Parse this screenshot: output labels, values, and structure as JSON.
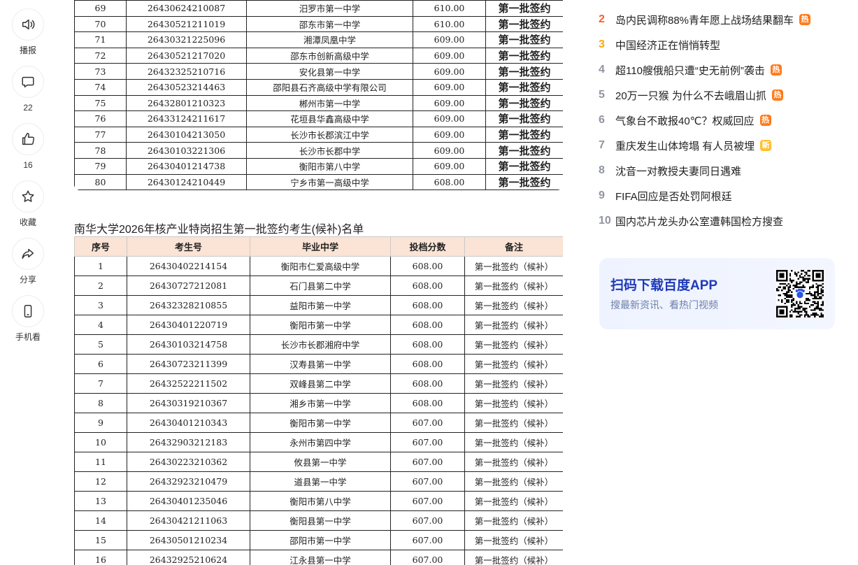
{
  "actions": [
    {
      "name": "broadcast-button",
      "icon": "speaker-icon",
      "label": "播报"
    },
    {
      "name": "comment-button",
      "icon": "comment-icon",
      "label": "22"
    },
    {
      "name": "like-button",
      "icon": "thumbs-up-icon",
      "label": "16"
    },
    {
      "name": "favorite-button",
      "icon": "star-icon",
      "label": "收藏"
    },
    {
      "name": "share-button",
      "icon": "share-icon",
      "label": "分享"
    },
    {
      "name": "mobile-view-button",
      "icon": "phone-icon",
      "label": "手机看"
    }
  ],
  "table1": {
    "status_label": "第一批签约",
    "rows": [
      [
        "69",
        "26430624210087",
        "汨罗市第一中学",
        "610.00"
      ],
      [
        "70",
        "26430521211019",
        "邵东市第一中学",
        "610.00"
      ],
      [
        "71",
        "26430321225096",
        "湘潭凤凰中学",
        "609.00"
      ],
      [
        "72",
        "26430521217020",
        "邵东市创新高级中学",
        "609.00"
      ],
      [
        "73",
        "26432325210716",
        "安化县第一中学",
        "609.00"
      ],
      [
        "74",
        "26430523214463",
        "邵阳县石齐高级中学有限公司",
        "609.00"
      ],
      [
        "75",
        "26432801210323",
        "郴州市第一中学",
        "609.00"
      ],
      [
        "76",
        "26433124211617",
        "花垣县华鑫高级中学",
        "609.00"
      ],
      [
        "77",
        "26430104213050",
        "长沙市长郡滨江中学",
        "609.00"
      ],
      [
        "78",
        "26430103221306",
        "长沙市长郡中学",
        "609.00"
      ],
      [
        "79",
        "26430401214738",
        "衡阳市第八中学",
        "609.00"
      ],
      [
        "80",
        "26430124210449",
        "宁乡市第一高级中学",
        "608.00"
      ]
    ]
  },
  "table2": {
    "title": "南华大学2026年核产业特岗招生第一批签约考生(候补)名单",
    "headers": [
      "序号",
      "考生号",
      "毕业中学",
      "投档分数",
      "备注"
    ],
    "remark": "第一批签约（候补）",
    "rows": [
      [
        "1",
        "26430402214154",
        "衡阳市仁爱高级中学",
        "608.00"
      ],
      [
        "2",
        "26430727212081",
        "石门县第二中学",
        "608.00"
      ],
      [
        "3",
        "26432328210855",
        "益阳市第一中学",
        "608.00"
      ],
      [
        "4",
        "26430401220719",
        "衡阳市第一中学",
        "608.00"
      ],
      [
        "5",
        "26430103214758",
        "长沙市长郡湘府中学",
        "608.00"
      ],
      [
        "6",
        "26430723211399",
        "汉寿县第一中学",
        "608.00"
      ],
      [
        "7",
        "26432522211502",
        "双峰县第二中学",
        "608.00"
      ],
      [
        "8",
        "26430319210367",
        "湘乡市第一中学",
        "608.00"
      ],
      [
        "9",
        "26430401210343",
        "衡阳市第一中学",
        "607.00"
      ],
      [
        "10",
        "26432903212183",
        "永州市第四中学",
        "607.00"
      ],
      [
        "11",
        "26430223210362",
        "攸县第一中学",
        "607.00"
      ],
      [
        "12",
        "26432923210479",
        "道县第一中学",
        "607.00"
      ],
      [
        "13",
        "26430401235046",
        "衡阳市第八中学",
        "607.00"
      ],
      [
        "14",
        "26430421211063",
        "衡阳县第一中学",
        "607.00"
      ],
      [
        "15",
        "26430501210234",
        "邵阳市第一中学",
        "607.00"
      ],
      [
        "16",
        "26432925210624",
        "江永县第一中学",
        "607.00"
      ]
    ]
  },
  "hot_list": [
    {
      "rank": "2",
      "title": "岛内民调称88%青年愿上战场结果翻车",
      "badge": "热",
      "badge_type": "hot"
    },
    {
      "rank": "3",
      "title": "中国经济正在悄悄转型",
      "badge": "",
      "badge_type": ""
    },
    {
      "rank": "4",
      "title": "超110艘俄船只遭“史无前例”袭击",
      "badge": "热",
      "badge_type": "hot"
    },
    {
      "rank": "5",
      "title": "20万一只猴 为什么不去峨眉山抓",
      "badge": "热",
      "badge_type": "hot"
    },
    {
      "rank": "6",
      "title": "气象台不敢报40℃？权威回应",
      "badge": "热",
      "badge_type": "hot"
    },
    {
      "rank": "7",
      "title": "重庆发生山体垮塌 有人员被埋",
      "badge": "新",
      "badge_type": "new"
    },
    {
      "rank": "8",
      "title": "沈音一对教授夫妻同日遇难",
      "badge": "",
      "badge_type": ""
    },
    {
      "rank": "9",
      "title": "FIFA回应是否处罚阿根廷",
      "badge": "",
      "badge_type": ""
    },
    {
      "rank": "10",
      "title": "国内芯片龙头办公室遭韩国检方搜查",
      "badge": "",
      "badge_type": ""
    }
  ],
  "app_card": {
    "title": "扫码下载百度APP",
    "subtitle": "搜最新资讯、看热门视频"
  },
  "colors": {
    "rank2": "#fe5f2d",
    "rank3": "#faa90e",
    "hot_badge": "#ff7a1a",
    "new_badge": "#ffc02b",
    "table_title_bg": "#f28c36",
    "table_header_bg": "#fbe4d5",
    "app_title": "#1f3ab8"
  }
}
